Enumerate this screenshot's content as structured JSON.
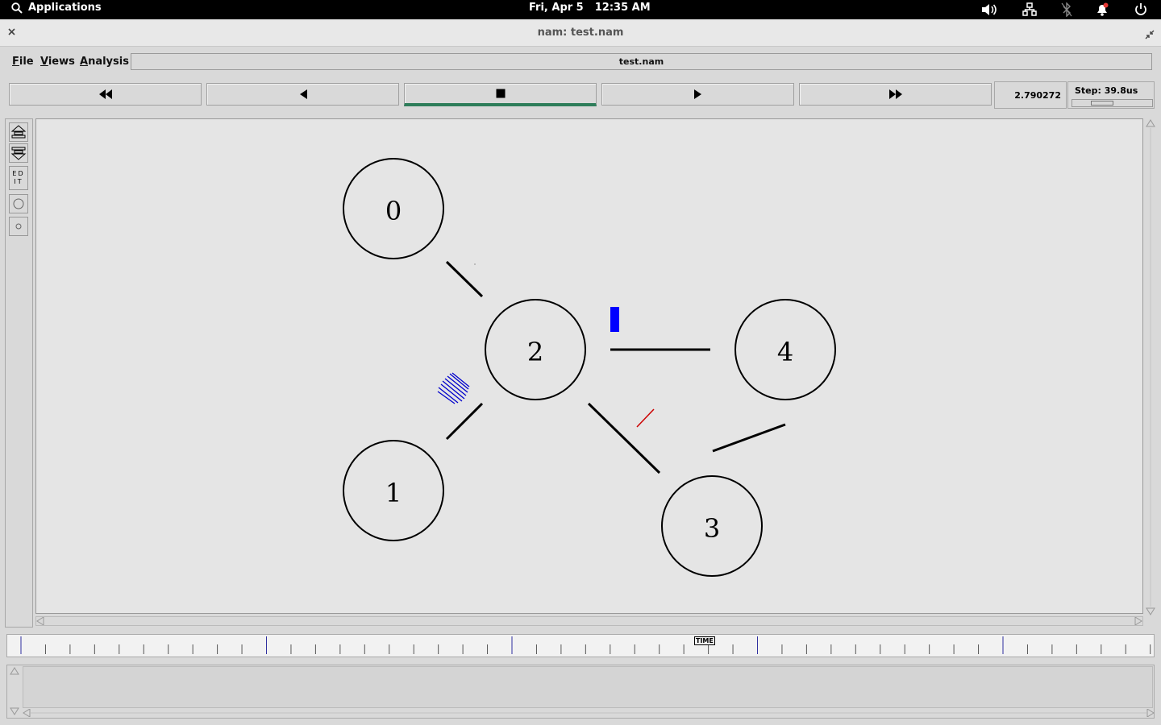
{
  "topbar": {
    "applications_label": "Applications",
    "date": "Fri, Apr  5",
    "time": "12:35 AM"
  },
  "window": {
    "title": "nam: test.nam"
  },
  "menubar": {
    "items": [
      "File",
      "Views",
      "Analysis"
    ],
    "filename": "test.nam"
  },
  "playback": {
    "buttons": [
      "rewind",
      "step-back",
      "stop",
      "play",
      "fast-forward"
    ],
    "active_button": "stop",
    "time": "2.790272",
    "step_label": "Step: 39.8us"
  },
  "tools": {
    "edit_label": "EDIT"
  },
  "network": {
    "nodes": [
      {
        "label": "0"
      },
      {
        "label": "1"
      },
      {
        "label": "2"
      },
      {
        "label": "3"
      },
      {
        "label": "4"
      }
    ],
    "links": [
      [
        "0",
        "2"
      ],
      [
        "1",
        "2"
      ],
      [
        "2",
        "4"
      ],
      [
        "2",
        "3"
      ],
      [
        "3",
        "4"
      ]
    ],
    "packet_colors": {
      "queue": "#0000ff",
      "packet": "#0000ff",
      "drop": "#cc0000"
    }
  },
  "timeline": {
    "marker_label": "TIME"
  },
  "colors": {
    "system_bar": "#000000",
    "canvas": "#e5e5e5",
    "active_indicator": "#2e7d5a"
  }
}
